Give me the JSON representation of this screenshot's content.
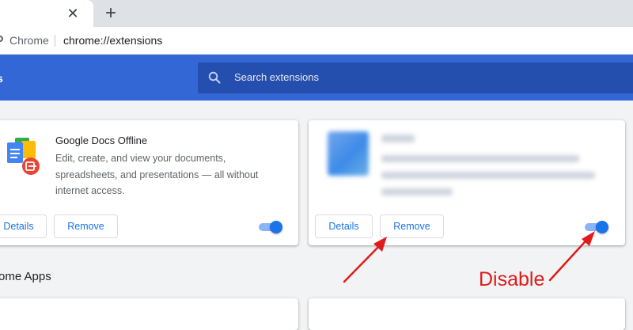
{
  "browser": {
    "new_tab_symbol": "+",
    "tab_close_symbol": "✕",
    "omnibox_site_label": "Chrome",
    "omnibox_url": "chrome://extensions"
  },
  "header": {
    "title": "s",
    "search_placeholder": "Search extensions"
  },
  "extensions": [
    {
      "name": "Google Docs Offline",
      "description_lines": [
        "Edit, create, and view your documents,",
        "spreadsheets, and presentations — all without",
        "internet access."
      ],
      "details_label": "Details",
      "remove_label": "Remove",
      "enabled": true
    },
    {
      "name": "",
      "details_label": "Details",
      "remove_label": "Remove",
      "enabled": true
    }
  ],
  "sections": {
    "apps_title": "rome Apps"
  },
  "annotation": {
    "label": "Disable",
    "color": "#e01b1b"
  },
  "colors": {
    "header_blue": "#3367d6",
    "accent": "#1a73e8"
  }
}
